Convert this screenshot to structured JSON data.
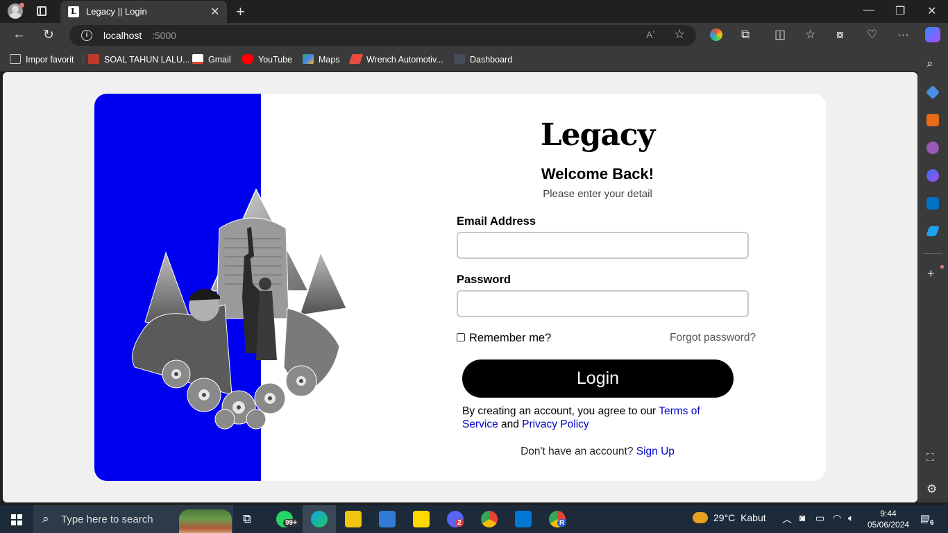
{
  "browser": {
    "tab_title": "Legacy || Login",
    "tab_favicon": "L",
    "url_host": "localhost",
    "url_port": ":5000",
    "read_aloud": "Aʼ"
  },
  "bookmarks": [
    {
      "label": "Impor favorit",
      "color": "#cccccc"
    },
    {
      "label": "SOAL TAHUN LALU...",
      "color": "#c0392b"
    },
    {
      "label": "Gmail",
      "color": "#ea4335"
    },
    {
      "label": "YouTube",
      "color": "#ff0000"
    },
    {
      "label": "Maps",
      "color": "#34a853"
    },
    {
      "label": "Wrench Automotiv...",
      "color": "#e74c3c"
    },
    {
      "label": "Dashboard",
      "color": "#444c5c"
    }
  ],
  "login": {
    "brand": "Legacy",
    "heading": "Welcome Back!",
    "subheading": "Please enter your detail",
    "email_label": "Email Address",
    "email_value": "",
    "password_label": "Password",
    "password_value": "",
    "remember_label": "Remember me?",
    "remember_checked": false,
    "forgot_label": "Forgot password?",
    "login_button": "Login",
    "terms_prefix": "By creating an account, you agree to our ",
    "terms_link": "Terms of Service",
    "terms_and": " and ",
    "privacy_link": "Privacy Policy",
    "signup_prefix": "Don't have an account? ",
    "signup_link": "Sign Up",
    "panel_color": "#0000f0"
  },
  "taskbar": {
    "search_placeholder": "Type here to search",
    "whatsapp_badge": "99+",
    "discord_badge": "2",
    "chrome_r_badge": "R",
    "weather_temp": "29°C",
    "weather_desc": "Kabut",
    "time": "9:44",
    "date": "05/06/2024",
    "notifications": "6"
  }
}
